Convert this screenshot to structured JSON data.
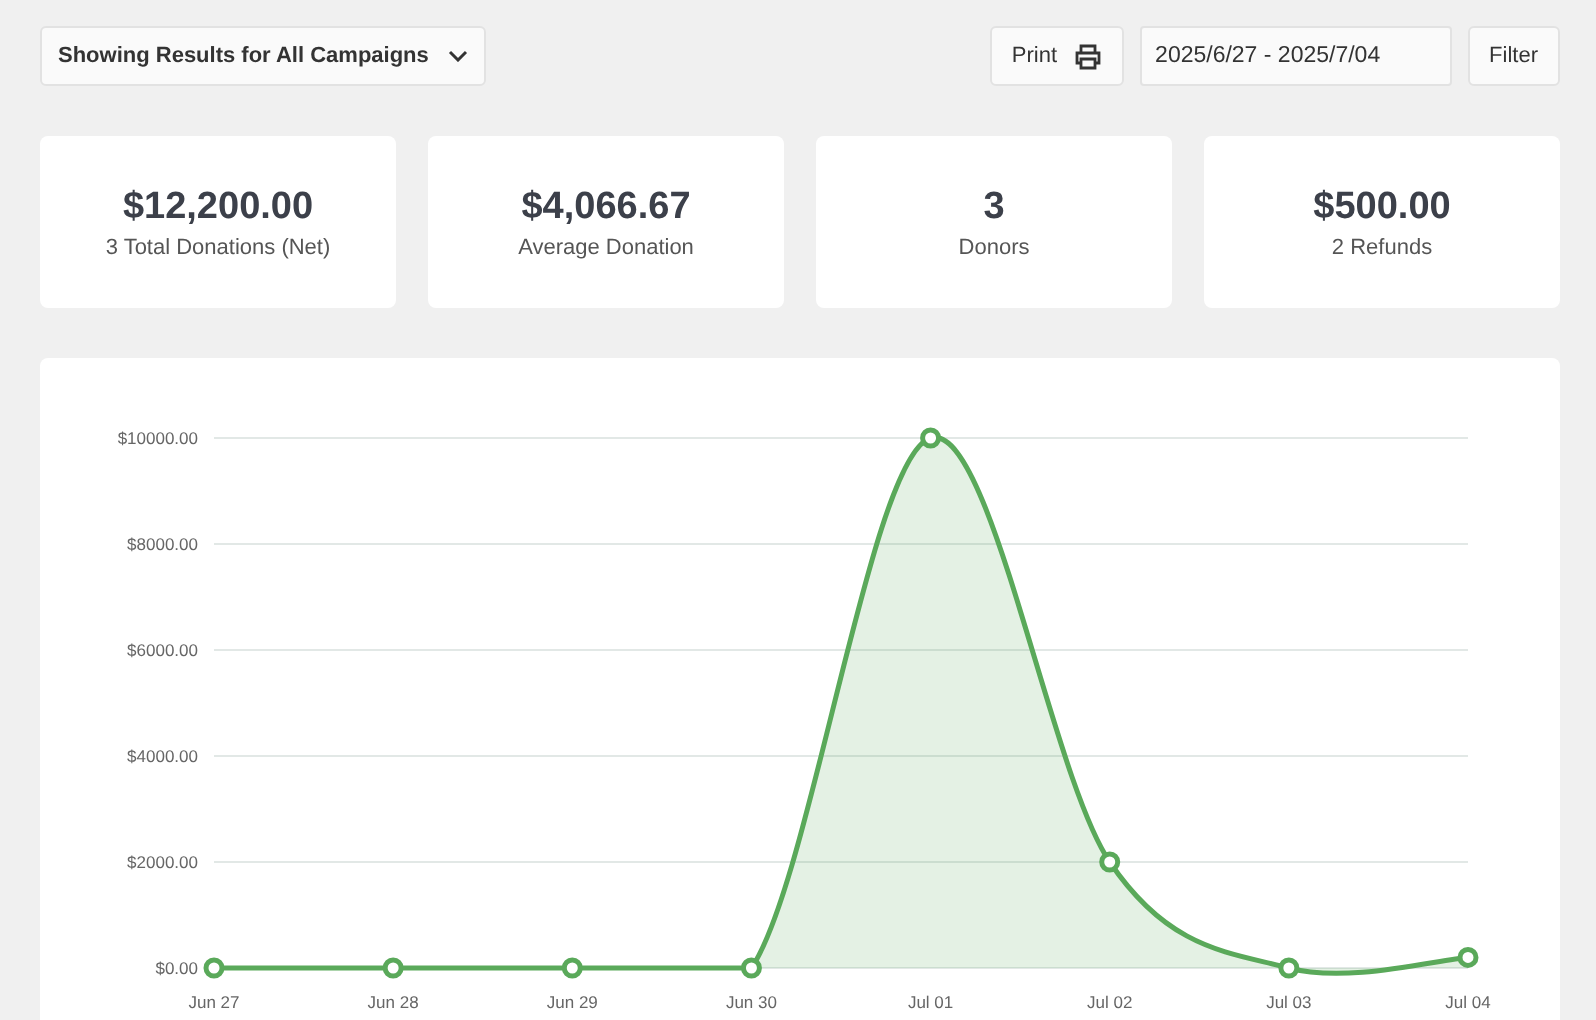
{
  "campaign_filter": {
    "label": "Showing Results for All Campaigns"
  },
  "print_button": {
    "label": "Print"
  },
  "date_range": {
    "value": "2025/6/27 - 2025/7/04"
  },
  "filter_button": {
    "label": "Filter"
  },
  "stats": [
    {
      "value": "$12,200.00",
      "label": "3 Total Donations (Net)"
    },
    {
      "value": "$4,066.67",
      "label": "Average Donation"
    },
    {
      "value": "3",
      "label": "Donors"
    },
    {
      "value": "$500.00",
      "label": "2 Refunds"
    }
  ],
  "chart": {
    "chart_data": {
      "type": "area",
      "categories": [
        "Jun 27",
        "Jun 28",
        "Jun 29",
        "Jun 30",
        "Jul 01",
        "Jul 02",
        "Jul 03",
        "Jul 04"
      ],
      "grid": true,
      "series": [
        {
          "color": "#5aa95a",
          "values": [
            0,
            0,
            0,
            0,
            10000,
            2000,
            0,
            200
          ]
        }
      ],
      "ylim": [
        0,
        10000
      ],
      "yticks": [
        {
          "value": 0,
          "label": "$0.00"
        },
        {
          "value": 2000,
          "label": "$2000.00"
        },
        {
          "value": 4000,
          "label": "$4000.00"
        },
        {
          "value": 6000,
          "label": "$6000.00"
        },
        {
          "value": 8000,
          "label": "$8000.00"
        },
        {
          "value": 10000,
          "label": "$10000.00"
        }
      ]
    }
  }
}
